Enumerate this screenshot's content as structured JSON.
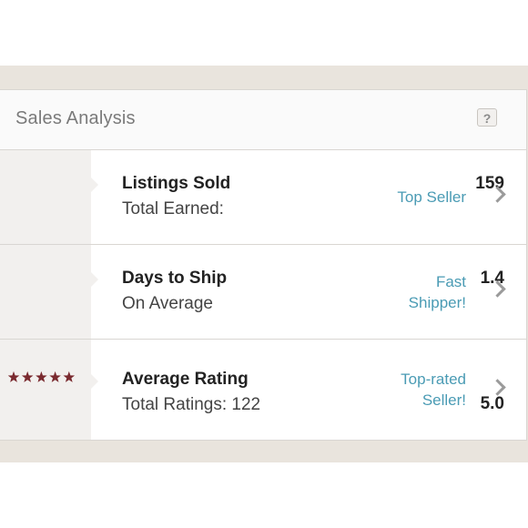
{
  "header": {
    "title": "Sales Analysis",
    "help_label": "?"
  },
  "rows": [
    {
      "stat": "159",
      "title": "Listings Sold",
      "subtitle": "Total Earned:",
      "badge": "Top Seller"
    },
    {
      "stat": "1.4",
      "title": "Days to Ship",
      "subtitle": "On Average",
      "badge_line1": "Fast",
      "badge_line2": "Shipper!"
    },
    {
      "stat": "5.0",
      "stars": 5,
      "title": "Average Rating",
      "subtitle": "Total Ratings: 122",
      "badge_line1": "Top-rated",
      "badge_line2": "Seller!"
    }
  ],
  "icons": {
    "help": "question-mark-icon",
    "row_arrow": "chevron-right-icon",
    "rating": "star-icon"
  },
  "colors": {
    "accent_link": "#4a9bb4",
    "star": "#7a2a2f",
    "panel_bg": "#e9e4dd"
  }
}
